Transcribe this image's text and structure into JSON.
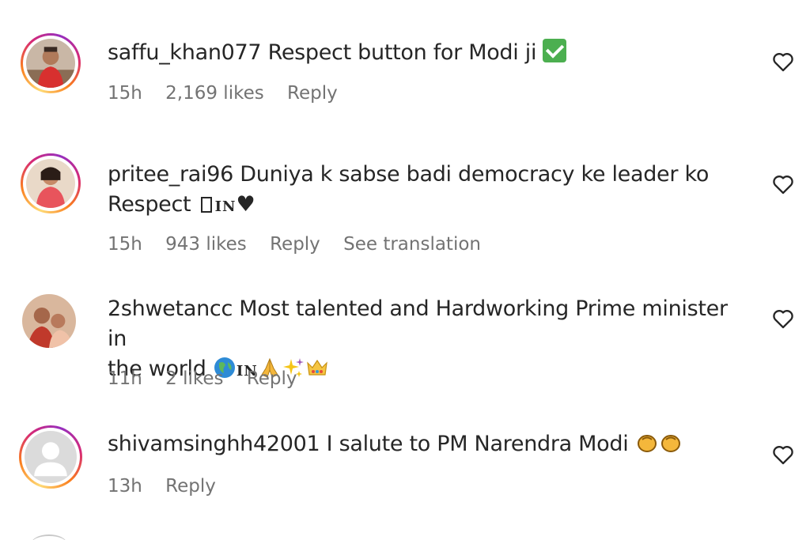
{
  "comments": [
    {
      "username": "saffu_khan077",
      "text": "Respect button for Modi ji",
      "emoji": "check-mark-emoji",
      "time": "15h",
      "likes": "2,169 likes",
      "reply": "Reply"
    },
    {
      "username": "pritee_rai96",
      "text_line1": "Duniya k sabse badi democracy ke leader ko",
      "text_line2": "Respect",
      "flag": "IN",
      "heart_glyph": "♥",
      "time": "15h",
      "likes": "943 likes",
      "reply": "Reply",
      "translate": "See translation"
    },
    {
      "username": "2shwetancc",
      "text_line1": "Most talented and Hardworking Prime minister in",
      "text_line2": "the world",
      "flag": "IN",
      "emojis": [
        "globe-emoji",
        "folded-hands-emoji",
        "sparkles-emoji",
        "crown-emoji"
      ],
      "time": "11h",
      "likes": "2 likes",
      "reply": "Reply"
    },
    {
      "username": "shivamsinghh42001",
      "text": "I salute to PM Narendra Modi",
      "emojis": [
        "clapping-hands-emoji",
        "clapping-hands-emoji"
      ],
      "time": "13h",
      "reply": "Reply"
    }
  ],
  "colors": {
    "text": "#262626",
    "meta": "#737373",
    "story_ring": [
      "#feda75",
      "#fa7e1e",
      "#d62976",
      "#962fbf"
    ],
    "check": "#4caf50"
  }
}
